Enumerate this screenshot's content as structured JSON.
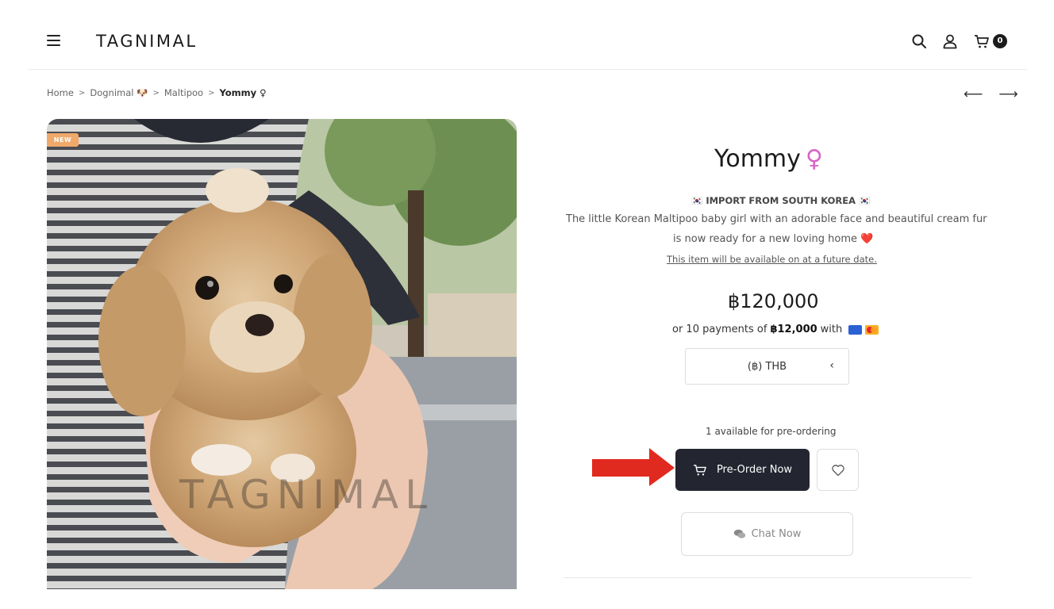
{
  "header": {
    "logo": "TAGNIMAL",
    "cart_count": "0"
  },
  "breadcrumb": {
    "home": "Home",
    "category": "Dognimal 🐶",
    "breed": "Maltipoo",
    "current": "Yommy ♀"
  },
  "nav": {
    "prev": "⟵",
    "next": "⟶"
  },
  "product": {
    "badge": "NEW",
    "watermark": "TAGNIMAL",
    "name": "Yommy",
    "gender_symbol": "♀",
    "import_line": "🇰🇷 IMPORT FROM SOUTH KOREA 🇰🇷",
    "description_line1": "The little Korean Maltipoo baby girl with an adorable face and beautiful cream fur",
    "description_line2": "is now ready for a new loving home",
    "description_heart": "❤️",
    "availability_note": "This item will be available on at a future date.",
    "price": "฿120,000",
    "installments_prefix": "or 10 payments of",
    "installments_amount": "฿12,000",
    "installments_suffix": "with",
    "currency": "(฿) THB",
    "stock_note": "1 available for pre-ordering",
    "preorder_label": "Pre-Order Now",
    "chat_label": "Chat Now"
  },
  "colors": {
    "accent_dark": "#232530",
    "arrow_red": "#e12a1f",
    "gender_pink": "#d765c4",
    "badge_orange": "#f0a96a"
  },
  "icons": {
    "menu": "hamburger-menu-icon",
    "search": "search-icon",
    "account": "user-icon",
    "cart": "cart-icon",
    "wishlist": "heart-icon",
    "chat": "chat-bubbles-icon"
  }
}
